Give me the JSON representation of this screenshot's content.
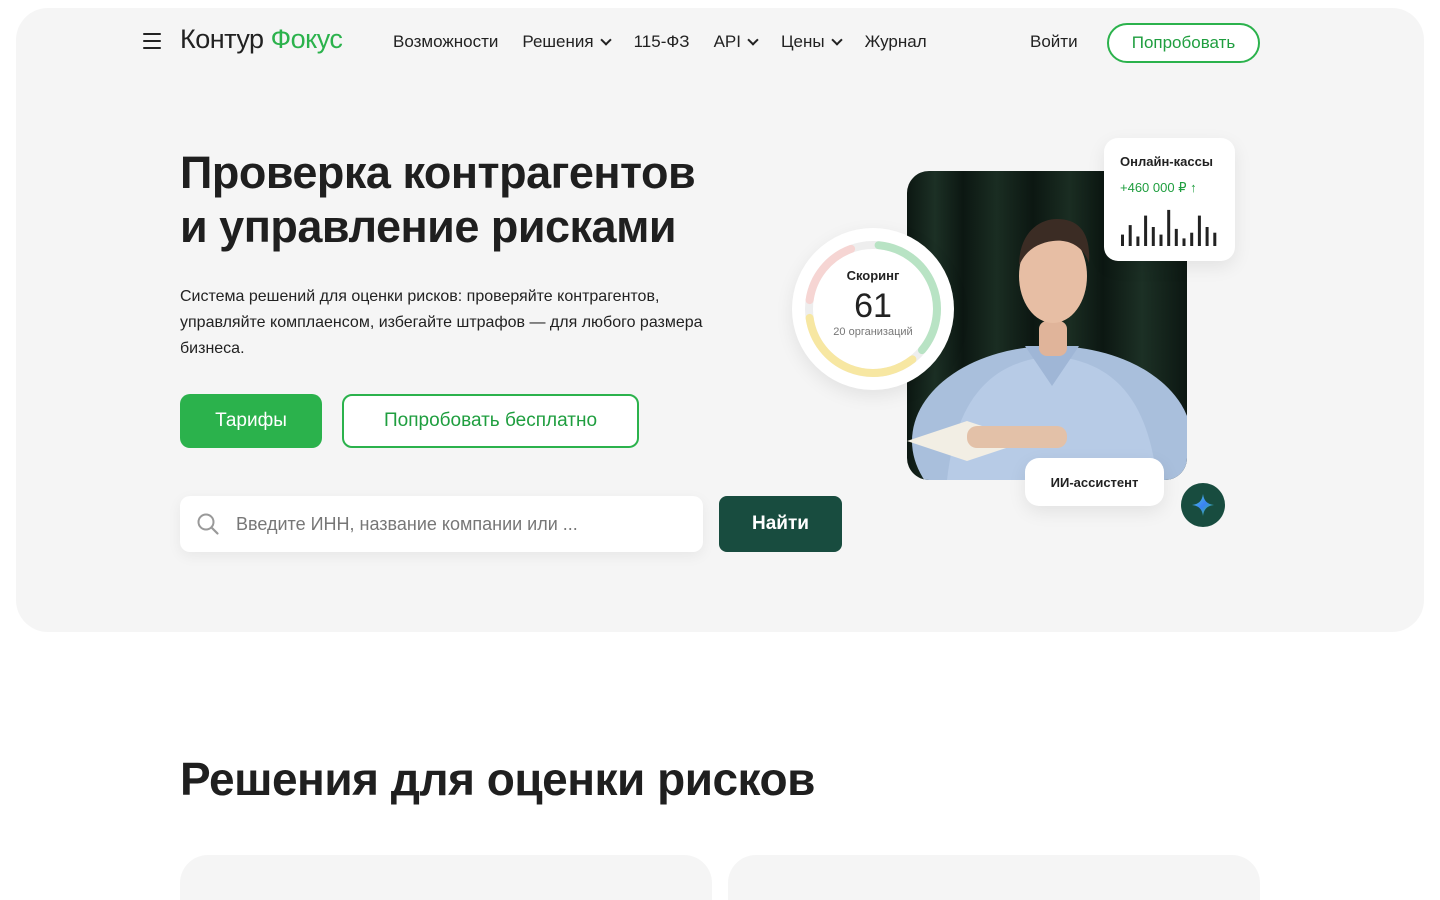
{
  "header": {
    "logo_part1": "Контур",
    "logo_part2": "Фокус",
    "nav": [
      {
        "label": "Возможности",
        "has_chevron": false
      },
      {
        "label": "Решения",
        "has_chevron": true
      },
      {
        "label": "115-ФЗ",
        "has_chevron": false
      },
      {
        "label": "API",
        "has_chevron": true
      },
      {
        "label": "Цены",
        "has_chevron": true
      },
      {
        "label": "Журнал",
        "has_chevron": false
      }
    ],
    "login_label": "Войти",
    "try_label": "Попробовать"
  },
  "hero": {
    "title_line1": "Проверка контрагентов",
    "title_line2": "и управление рисками",
    "lead": "Система решений для оценки рисков: проверяйте контрагентов, управляйте комплаенсом, избегайте штрафов — для любого размера бизнеса.",
    "primary_button": "Тарифы",
    "outline_button": "Попробовать бесплатно",
    "search_placeholder": "Введите ИНН, название компании или ...",
    "search_button": "Найти"
  },
  "illustration": {
    "scoring": {
      "title": "Скоринг",
      "value": "61",
      "subtitle": "20 организаций"
    },
    "kassy": {
      "title": "Онлайн-кассы",
      "value": "+460 000 ₽ ↑",
      "bars": [
        0.3,
        0.55,
        0.25,
        0.8,
        0.5,
        0.3,
        0.95,
        0.45,
        0.2,
        0.35,
        0.8,
        0.5,
        0.35
      ]
    },
    "ai_label": "ИИ-ассистент"
  },
  "solutions": {
    "title": "Решения для оценки рисков"
  },
  "colors": {
    "brand_green": "#2bb24c",
    "dark_green": "#184c3f",
    "hero_bg": "#f5f5f5"
  }
}
